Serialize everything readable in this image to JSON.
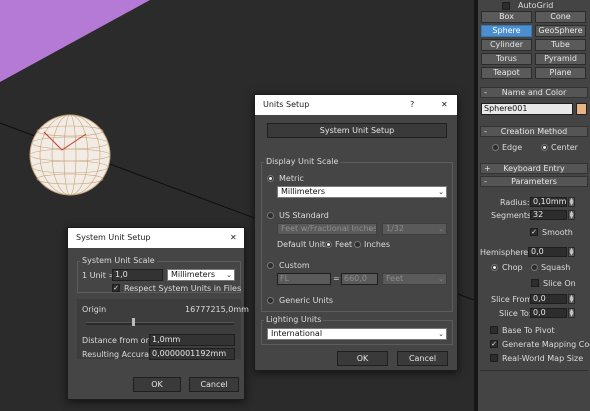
{
  "colors": {
    "viewport_bg": "#2b2b2b",
    "sphere_wire": "#c2a27a",
    "purple_bg": "#b57ad6",
    "selected_button": "#4a8fd0",
    "swatch": "#e7b586"
  },
  "command_panel": {
    "autogrid_label": "AutoGrid",
    "object_buttons": [
      "Box",
      "Cone",
      "Sphere",
      "GeoSphere",
      "Cylinder",
      "Tube",
      "Torus",
      "Pyramid",
      "Teapot",
      "Plane"
    ],
    "selected_object": "Sphere",
    "name_color": {
      "header": "Name and Color",
      "name_value": "Sphere001"
    },
    "creation_method": {
      "header": "Creation Method",
      "edge": "Edge",
      "center": "Center"
    },
    "keyboard_entry_header": "Keyboard Entry",
    "parameters": {
      "header": "Parameters",
      "radius_label": "Radius:",
      "radius_value": "0,10mm",
      "segments_label": "Segments:",
      "segments_value": "32",
      "smooth_label": "Smooth",
      "hemisphere_label": "Hemisphere:",
      "hemisphere_value": "0,0",
      "chop": "Chop",
      "squash": "Squash",
      "slice_on": "Slice On",
      "slice_from_label": "Slice From:",
      "slice_from_value": "0,0",
      "slice_to_label": "Slice To:",
      "slice_to_value": "0,0",
      "base_to_pivot": "Base To Pivot",
      "gen_mapping": "Generate Mapping Coords.",
      "real_world": "Real-World Map Size"
    },
    "roll_minus": "-"
  },
  "units_setup": {
    "title": "Units Setup",
    "help_icon": "?",
    "close_icon": "✕",
    "system_unit_setup_button": "System Unit Setup",
    "display_unit_scale": "Display Unit Scale",
    "metric_label": "Metric",
    "metric_value": "Millimeters",
    "us_standard_label": "US Standard",
    "us_value": "Feet w/Fractional Inches",
    "us_fraction": "1/32",
    "default_units_label": "Default Units:",
    "feet": "Feet",
    "inches": "Inches",
    "custom_label": "Custom",
    "custom_name": "FL",
    "custom_equals": "=",
    "custom_value": "660,0",
    "custom_unit": "Feet",
    "generic_label": "Generic Units",
    "lighting_units": "Lighting Units",
    "lighting_value": "International",
    "ok": "OK",
    "cancel": "Cancel"
  },
  "system_unit_setup": {
    "title": "System Unit Setup",
    "close_icon": "✕",
    "group_title": "System Unit Scale",
    "unit_label": "1 Unit =",
    "unit_value": "1,0",
    "unit_type": "Millimeters",
    "respect_label": "Respect System Units in Files",
    "origin_label": "Origin",
    "origin_value": "16777215,0mm",
    "distance_label": "Distance from origin:",
    "distance_value": "1,0mm",
    "accuracy_label": "Resulting Accuracy:",
    "accuracy_value": "0,0000001192mm",
    "ok": "OK",
    "cancel": "Cancel"
  }
}
